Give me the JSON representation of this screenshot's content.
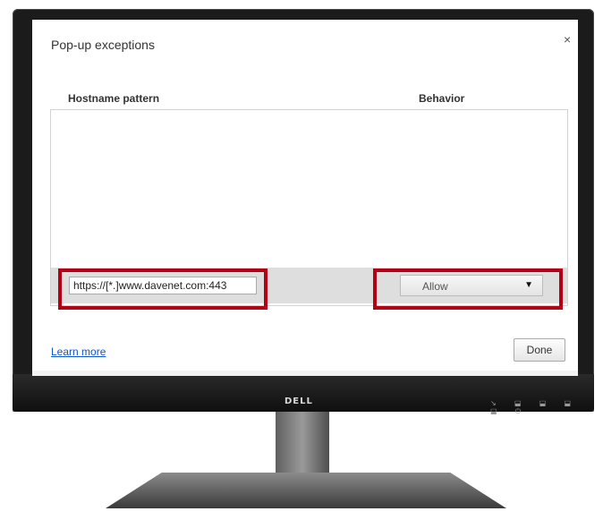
{
  "dialog": {
    "title": "Pop-up exceptions",
    "close_symbol": "×"
  },
  "table": {
    "columns": [
      "Hostname pattern",
      "Behavior"
    ],
    "rows": [
      {
        "hostname": "https://[*.]www.davenet.com:443",
        "behavior": "Allow"
      }
    ]
  },
  "footer": {
    "learn_more": "Learn more",
    "done": "Done"
  },
  "monitor": {
    "brand": "DELL",
    "button_icons": "↘ ⬓ ⬓ ⬓ ⬓ ⏻"
  },
  "colors": {
    "highlight": "#b30014",
    "link": "#1155cc"
  }
}
